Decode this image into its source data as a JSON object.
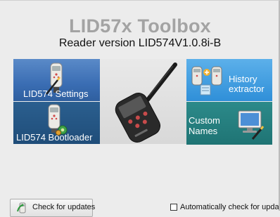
{
  "app": {
    "title": "LID57x Toolbox",
    "reader_version": "Reader version LID574V1.0.8i-B"
  },
  "tiles": {
    "settings": {
      "label": "LID574 Settings",
      "icon": "handheld-reader-pen-icon"
    },
    "bootloader": {
      "label": "LID574 Bootloader",
      "icon": "handheld-reader-gear-icon"
    },
    "device": {
      "icon": "lid574-reader-device-image"
    },
    "history": {
      "label_line1": "History",
      "label_line2": "extractor",
      "icon": "history-extractor-icon"
    },
    "custom": {
      "label_line1": "Custom",
      "label_line2": "Names",
      "icon": "monitor-edit-icon"
    }
  },
  "footer": {
    "check_button": "Check for updates",
    "check_icon": "check-updates-icon",
    "auto_check_label": "Automatically check for updates",
    "auto_check_checked": false
  },
  "colors": {
    "title": "#a3a3a3",
    "settings_tile": "#3a6db3",
    "bootloader_tile": "#1f4d79",
    "history_tile": "#2f8fd8",
    "custom_tile": "#1f7474"
  }
}
